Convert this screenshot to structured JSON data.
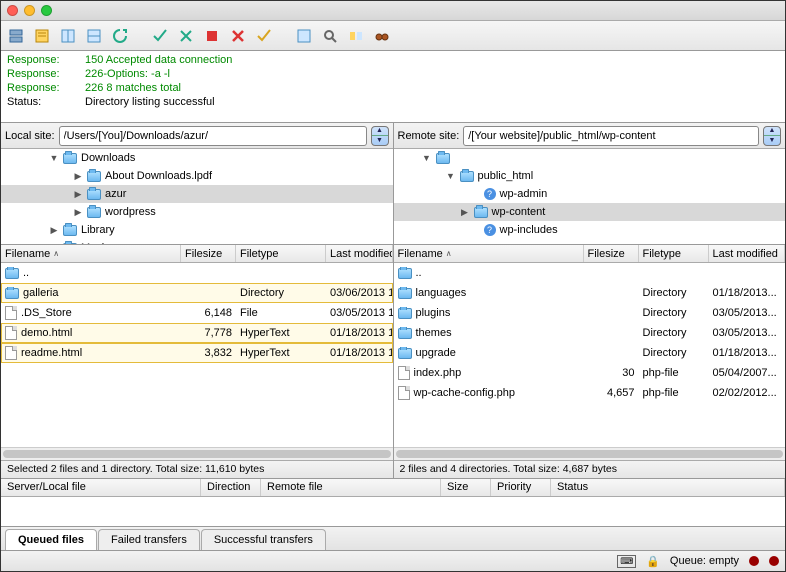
{
  "log": [
    {
      "label": "Response:",
      "text": "150 Accepted data connection",
      "cls": "green"
    },
    {
      "label": "Response:",
      "text": "226-Options: -a -l",
      "cls": "green"
    },
    {
      "label": "Response:",
      "text": "226 8 matches total",
      "cls": "green"
    },
    {
      "label": "Status:",
      "text": "Directory listing successful",
      "cls": ""
    }
  ],
  "local": {
    "label": "Local site:",
    "path": "/Users/[You]/Downloads/azur/",
    "tree": [
      {
        "indent": 48,
        "disc": "▼",
        "name": "Downloads",
        "icon": "folder"
      },
      {
        "indent": 72,
        "disc": "▶",
        "name": "About Downloads.lpdf",
        "icon": "folder"
      },
      {
        "indent": 72,
        "disc": "▶",
        "name": "azur",
        "icon": "folder",
        "selected": true
      },
      {
        "indent": 72,
        "disc": "▶",
        "name": "wordpress",
        "icon": "folder"
      },
      {
        "indent": 48,
        "disc": "▶",
        "name": "Library",
        "icon": "folder"
      },
      {
        "indent": 48,
        "disc": "",
        "name": "Movies",
        "icon": "folder"
      }
    ],
    "headers": {
      "name": "Filename",
      "size": "Filesize",
      "type": "Filetype",
      "mod": "Last modified"
    },
    "files": [
      {
        "name": "..",
        "size": "",
        "type": "",
        "mod": "",
        "icon": "dir",
        "sel": false
      },
      {
        "name": "galleria",
        "size": "",
        "type": "Directory",
        "mod": "03/06/2013 1",
        "icon": "dir",
        "sel": true
      },
      {
        "name": ".DS_Store",
        "size": "6,148",
        "type": "File",
        "mod": "03/05/2013 1",
        "icon": "file",
        "sel": false
      },
      {
        "name": "demo.html",
        "size": "7,778",
        "type": "HyperText",
        "mod": "01/18/2013 1",
        "icon": "file",
        "sel": true
      },
      {
        "name": "readme.html",
        "size": "3,832",
        "type": "HyperText",
        "mod": "01/18/2013 1",
        "icon": "file",
        "sel": true
      }
    ],
    "status": "Selected 2 files and 1 directory. Total size: 11,610 bytes"
  },
  "remote": {
    "label": "Remote site:",
    "path": "/[Your website]/public_html/wp-content",
    "tree": [
      {
        "indent": 28,
        "disc": "▼",
        "name": "",
        "icon": "folder"
      },
      {
        "indent": 52,
        "disc": "▼",
        "name": "public_html",
        "icon": "folder"
      },
      {
        "indent": 76,
        "disc": "",
        "name": "wp-admin",
        "icon": "q"
      },
      {
        "indent": 66,
        "disc": "▶",
        "name": "wp-content",
        "icon": "folder",
        "selected": true
      },
      {
        "indent": 76,
        "disc": "",
        "name": "wp-includes",
        "icon": "q"
      }
    ],
    "headers": {
      "name": "Filename",
      "size": "Filesize",
      "type": "Filetype",
      "mod": "Last modified"
    },
    "files": [
      {
        "name": "..",
        "size": "",
        "type": "",
        "mod": "",
        "icon": "dir"
      },
      {
        "name": "languages",
        "size": "",
        "type": "Directory",
        "mod": "01/18/2013...",
        "icon": "dir"
      },
      {
        "name": "plugins",
        "size": "",
        "type": "Directory",
        "mod": "03/05/2013...",
        "icon": "dir"
      },
      {
        "name": "themes",
        "size": "",
        "type": "Directory",
        "mod": "03/05/2013...",
        "icon": "dir"
      },
      {
        "name": "upgrade",
        "size": "",
        "type": "Directory",
        "mod": "01/18/2013...",
        "icon": "dir"
      },
      {
        "name": "index.php",
        "size": "30",
        "type": "php-file",
        "mod": "05/04/2007...",
        "icon": "file"
      },
      {
        "name": "wp-cache-config.php",
        "size": "4,657",
        "type": "php-file",
        "mod": "02/02/2012...",
        "icon": "file"
      }
    ],
    "status": "2 files and 4 directories. Total size: 4,687 bytes"
  },
  "queue": {
    "h1": "Server/Local file",
    "h2": "Direction",
    "h3": "Remote file",
    "h4": "Size",
    "h5": "Priority",
    "h6": "Status"
  },
  "tabs": {
    "t1": "Queued files",
    "t2": "Failed transfers",
    "t3": "Successful transfers"
  },
  "footer": {
    "queue": "Queue: empty"
  },
  "colors": {
    "red": "#ff5f57",
    "yellow": "#ffbd2e",
    "green": "#28c940"
  }
}
